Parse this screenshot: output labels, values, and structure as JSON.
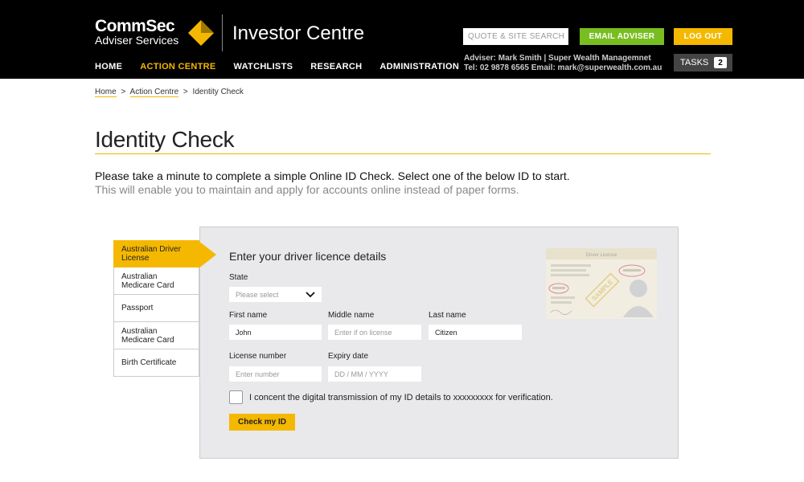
{
  "header": {
    "brand": "CommSec",
    "brand_sub": "Adviser Services",
    "product_title": "Investor Centre",
    "search_placeholder": "QUOTE & SITE SEARCH",
    "email_adviser_label": "EMAIL ADVISER",
    "logout_label": "LOG OUT",
    "adviser_line1": "Adviser: Mark Smith | Super Wealth Managemnet",
    "adviser_line2": "Tel: 02 9878 6565   Email: mark@superwealth.com.au",
    "tasks_label": "TASKS",
    "tasks_count": "2",
    "accent_color": "#f5b800",
    "email_button_color": "#78be20"
  },
  "nav": {
    "items": [
      {
        "label": "HOME",
        "active": false
      },
      {
        "label": "ACTION CENTRE",
        "active": true
      },
      {
        "label": "WATCHLISTS",
        "active": false
      },
      {
        "label": "RESEARCH",
        "active": false
      },
      {
        "label": "ADMINISTRATION",
        "active": false
      }
    ]
  },
  "breadcrumb": {
    "items": [
      "Home",
      "Action Centre"
    ],
    "current": "Identity Check",
    "separator": ">"
  },
  "page": {
    "title": "Identity Check",
    "intro_main": "Please take a minute to complete a simple Online ID Check. Select one of the below ID to start.",
    "intro_sub": "This will enable you to maintain and apply for accounts online instead of paper forms."
  },
  "id_tabs": [
    {
      "label": "Australian Driver License",
      "active": true
    },
    {
      "label": "Australian Medicare Card",
      "active": false
    },
    {
      "label": "Passport",
      "active": false
    },
    {
      "label": "Australian Medicare Card",
      "active": false
    },
    {
      "label": "Birth Certificate",
      "active": false
    }
  ],
  "form": {
    "title": "Enter your driver licence details",
    "state_label": "State",
    "state_placeholder": "Please select",
    "first_name_label": "First name",
    "first_name_value": "John",
    "middle_name_label": "Middle name",
    "middle_name_placeholder": "Enter if on license",
    "last_name_label": "Last name",
    "last_name_value": "Citizen",
    "license_number_label": "License number",
    "license_number_placeholder": "Enter number",
    "expiry_label": "Expiry date",
    "expiry_placeholder": "DD / MM / YYYY",
    "consent_text": "I concent the digital transmission of my ID details to xxxxxxxxx for verification.",
    "submit_label": "Check my ID"
  },
  "license_card": {
    "heading": "Driver Licence",
    "stamp": "SAMPLE"
  }
}
